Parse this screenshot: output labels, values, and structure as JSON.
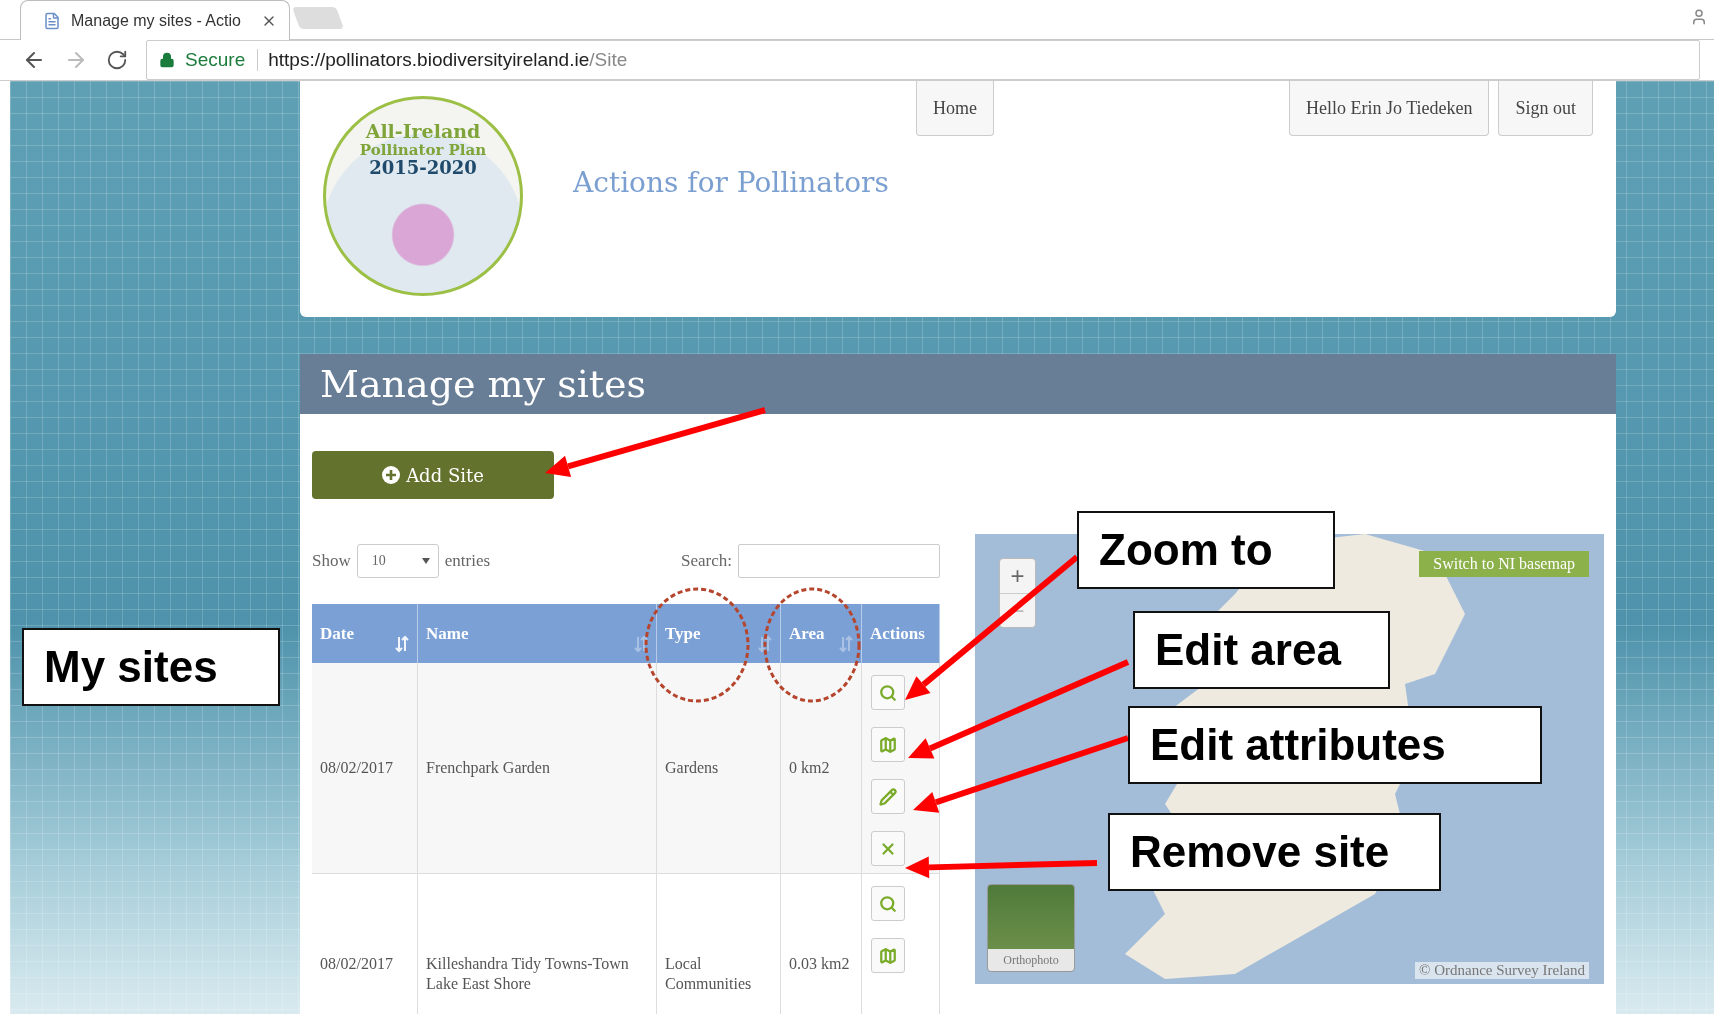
{
  "browser": {
    "tab_title": "Manage my sites - Actio",
    "secure_label": "Secure",
    "url_host": "https://pollinators.biodiversityireland.ie",
    "url_path": "/Site"
  },
  "header": {
    "logo_lines": [
      "All-Ireland",
      "Pollinator Plan",
      "2015-2020"
    ],
    "site_title": "Actions for Pollinators",
    "nav": [
      {
        "label": "Home",
        "kind": "left"
      },
      {
        "label": "Hello Erin Jo Tiedeken",
        "kind": "right"
      },
      {
        "label": "Sign out",
        "kind": "right"
      }
    ]
  },
  "page_title": "Manage my sites",
  "add_button": "Add Site",
  "table_controls": {
    "show_label": "Show",
    "page_size": "10",
    "entries_label": "entries",
    "search_label": "Search:"
  },
  "table": {
    "columns": [
      {
        "label": "Date",
        "kind": "sorted"
      },
      {
        "label": "Name",
        "kind": "sortable"
      },
      {
        "label": "Type",
        "kind": "sortable"
      },
      {
        "label": "Area",
        "kind": "sortable"
      },
      {
        "label": "Actions",
        "kind": "plain"
      }
    ],
    "rows": [
      {
        "date": "08/02/2017",
        "name": "Frenchpark Garden",
        "type": "Gardens",
        "area": "0 km2"
      },
      {
        "date": "08/02/2017",
        "name": "Killeshandra Tidy Towns-Town Lake East Shore",
        "type": "Local Communities",
        "area": "0.03 km2"
      }
    ]
  },
  "map": {
    "zoom_in": "+",
    "zoom_out": "−",
    "basemap_button": "Switch to NI basemap",
    "layer_label": "Orthophoto",
    "attribution": "© Ordnance Survey Ireland"
  },
  "annotations": [
    "My sites",
    "Zoom to",
    "Edit area",
    "Edit attributes",
    "Remove site"
  ]
}
